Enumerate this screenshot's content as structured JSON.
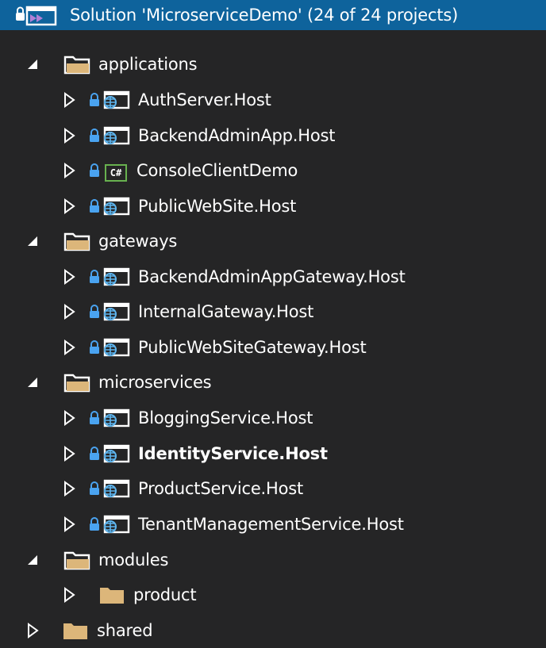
{
  "solution": {
    "label": "Solution 'MicroserviceDemo' (24 of 24 projects)"
  },
  "folders": {
    "applications": "applications",
    "gateways": "gateways",
    "microservices": "microservices",
    "modules": "modules",
    "product": "product",
    "shared": "shared"
  },
  "projects": {
    "auth_server": "AuthServer.Host",
    "backend_admin_app": "BackendAdminApp.Host",
    "console_client_demo": "ConsoleClientDemo",
    "public_web_site": "PublicWebSite.Host",
    "backend_admin_app_gateway": "BackendAdminAppGateway.Host",
    "internal_gateway": "InternalGateway.Host",
    "public_web_site_gateway": "PublicWebSiteGateway.Host",
    "blogging_service": "BloggingService.Host",
    "identity_service": "IdentityService.Host",
    "product_service": "ProductService.Host",
    "tenant_management_service": "TenantManagementService.Host"
  },
  "csharp_badge": "C#",
  "colors": {
    "background": "#252526",
    "selection": "#0e639c",
    "folder": "#dcb67a",
    "web_icon": "#5eb6f0",
    "csharp": "#68b14f",
    "lock": "#4aa3f0"
  }
}
